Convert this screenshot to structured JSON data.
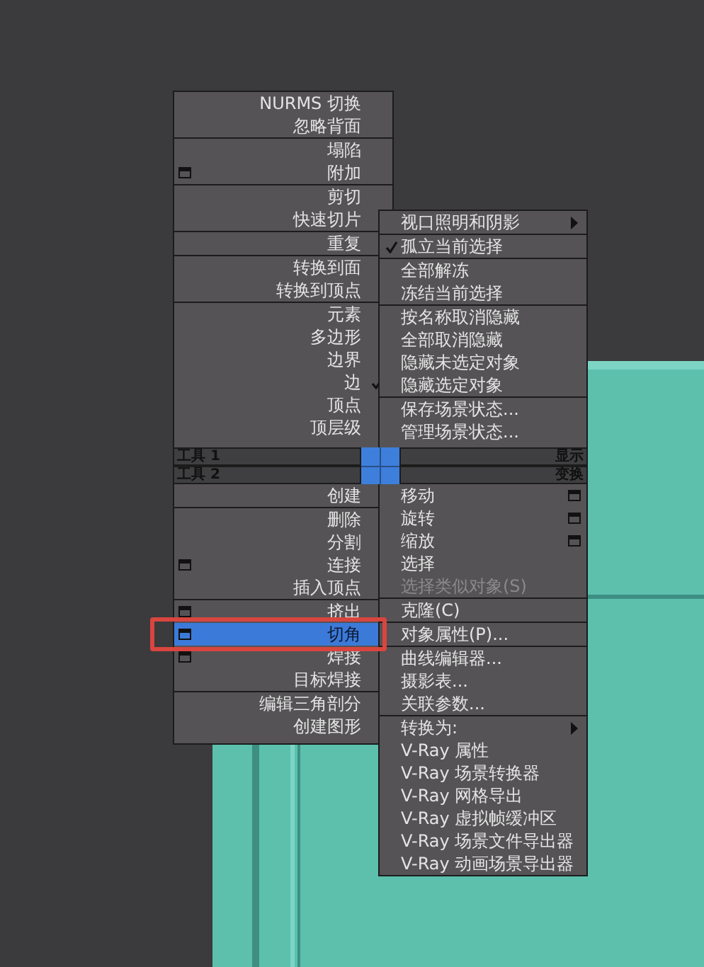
{
  "quad_menu": {
    "upper_left": {
      "groups": [
        [
          {
            "label": "NURMS 切换"
          },
          {
            "label": "忽略背面"
          }
        ],
        [
          {
            "label": "塌陷"
          },
          {
            "label": "附加",
            "option_box": true
          }
        ],
        [
          {
            "label": "剪切"
          },
          {
            "label": "快速切片"
          }
        ],
        [
          {
            "label": "重复"
          }
        ],
        [
          {
            "label": "转换到面"
          },
          {
            "label": "转换到顶点"
          }
        ],
        [
          {
            "label": "元素",
            "checked": false
          },
          {
            "label": "多边形",
            "checked": false
          },
          {
            "label": "边界",
            "checked": false
          },
          {
            "label": "边",
            "checked": true
          },
          {
            "label": "顶点",
            "checked": false
          },
          {
            "label": "顶层级",
            "checked": false
          }
        ]
      ]
    },
    "headers": {
      "left": [
        "工具 1",
        "工具 2"
      ],
      "right": [
        "显示",
        "变换"
      ]
    },
    "lower_left": {
      "groups": [
        [
          {
            "label": "创建",
            "selected": false
          }
        ],
        [
          {
            "label": "删除",
            "selected": false
          },
          {
            "label": "分割",
            "selected": false
          },
          {
            "label": "连接",
            "option_box": true,
            "selected": false
          },
          {
            "label": "插入顶点",
            "selected": false
          }
        ],
        [
          {
            "label": "挤出",
            "option_box": true,
            "selected": false
          },
          {
            "label": "切角",
            "option_box": true,
            "selected": true,
            "marked": true
          },
          {
            "label": "焊接",
            "option_box": true,
            "selected": false
          },
          {
            "label": "目标焊接",
            "selected": false
          }
        ],
        [
          {
            "label": "编辑三角剖分",
            "selected": false
          },
          {
            "label": "创建图形",
            "selected": false
          }
        ]
      ]
    },
    "upper_right": {
      "groups": [
        [
          {
            "label": "视口照明和阴影",
            "submenu": true
          }
        ],
        [
          {
            "label": "孤立当前选择",
            "checked": true
          }
        ],
        [
          {
            "label": "全部解冻"
          },
          {
            "label": "冻结当前选择"
          }
        ],
        [
          {
            "label": "按名称取消隐藏"
          },
          {
            "label": "全部取消隐藏"
          },
          {
            "label": "隐藏未选定对象"
          },
          {
            "label": "隐藏选定对象"
          }
        ],
        [
          {
            "label": "保存场景状态..."
          },
          {
            "label": "管理场景状态..."
          }
        ]
      ]
    },
    "lower_right": {
      "groups": [
        [
          {
            "label": "移动",
            "option_box": true
          },
          {
            "label": "旋转",
            "option_box": true
          },
          {
            "label": "缩放",
            "option_box": true
          },
          {
            "label": "选择"
          },
          {
            "label": "选择类似对象(S)",
            "disabled": true
          }
        ],
        [
          {
            "label": "克隆(C)"
          }
        ],
        [
          {
            "label": "对象属性(P)..."
          }
        ],
        [
          {
            "label": "曲线编辑器..."
          },
          {
            "label": "摄影表..."
          },
          {
            "label": "关联参数..."
          }
        ],
        [
          {
            "label": "转换为:",
            "submenu": true
          },
          {
            "label": "V-Ray 属性"
          },
          {
            "label": "V-Ray 场景转换器"
          },
          {
            "label": "V-Ray 网格导出"
          },
          {
            "label": "V-Ray 虚拟帧缓冲区"
          },
          {
            "label": "V-Ray 场景文件导出器"
          },
          {
            "label": "V-Ray 动画场景导出器"
          }
        ]
      ]
    }
  }
}
